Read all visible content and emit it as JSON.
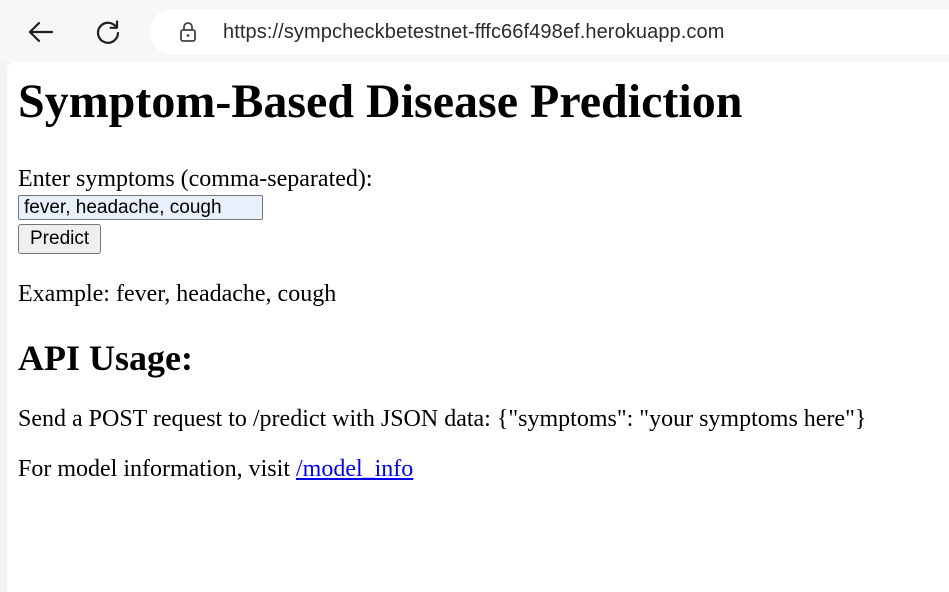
{
  "browser": {
    "url": "https://sympcheckbetestnet-fffc66f498ef.herokuapp.com",
    "back_icon": "arrow-left-icon",
    "reload_icon": "reload-icon",
    "lock_icon": "lock-icon"
  },
  "page": {
    "title": "Symptom-Based Disease Prediction",
    "form_label": "Enter symptoms (comma-separated):",
    "input_value": "fever, headache, cough",
    "predict_label": "Predict",
    "example_text": "Example: fever, headache, cough",
    "api_heading": "API Usage:",
    "api_text": "Send a POST request to /predict with JSON data: {\"symptoms\": \"your symptoms here\"}",
    "model_text": "For model information, visit ",
    "model_link": "/model_info"
  },
  "colors": {
    "link": "#0000ee",
    "input_autofill_bg": "#e8f0fe"
  }
}
